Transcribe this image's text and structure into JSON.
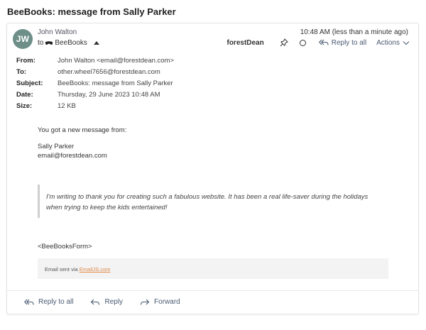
{
  "page_title": "BeeBooks: message from Sally Parker",
  "header": {
    "avatar_initials": "JW",
    "sender_name": "John Walton",
    "to_prefix": "to",
    "recipient_name": "BeeBooks",
    "timestamp": "10:48 AM (less than a minute ago)",
    "account": "forestDean",
    "reply_all_label": "Reply to all",
    "actions_label": "Actions"
  },
  "meta": [
    {
      "label": "From:",
      "value": "John Walton <email@forestdean.com>"
    },
    {
      "label": "To:",
      "value": "other.wheel7656@forestdean.com"
    },
    {
      "label": "Subject:",
      "value": "BeeBooks: message from Sally Parker"
    },
    {
      "label": "Date:",
      "value": "Thursday, 29 June 2023 10:48 AM"
    },
    {
      "label": "Size:",
      "value": "12 KB"
    }
  ],
  "body": {
    "intro": "You got a new message from:",
    "from_name": "Sally Parker",
    "from_email": "email@forestdean.com",
    "quote": "I'm writing to thank you for creating such a fabulous website. It has been a real life-saver during the holidays when trying to keep the kids entertained!",
    "form_tag": "<BeeBooksForm>",
    "footer_prefix": "Email sent via ",
    "footer_link": "EmailJS.com"
  },
  "bottom_actions": {
    "reply_all": "Reply to all",
    "reply": "Reply",
    "forward": "Forward"
  },
  "colors": {
    "avatar": "#6d8f87",
    "link_accent": "#e0894a",
    "action_text": "#4a5a72"
  }
}
